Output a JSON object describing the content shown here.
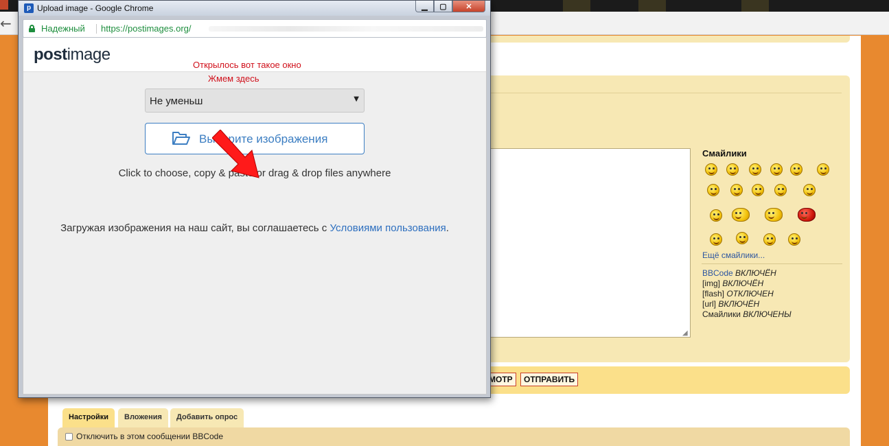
{
  "popup": {
    "window_title": "Upload image - Google Chrome",
    "favicon_letter": "p",
    "window_buttons": {
      "minimize": "▁",
      "maximize": "▢",
      "close": "✕"
    },
    "address_bar": {
      "secure_label": "Надежный",
      "url": "https://postimages.org/"
    },
    "logo": {
      "part1": "post",
      "part2": "image"
    },
    "annotations": [
      "Открылось вот такое окно",
      "Жмем здесь"
    ],
    "resize_select": {
      "value": "Не уменьш",
      "arrow": "▼"
    },
    "choose_button": {
      "label": "Выберите изображения"
    },
    "hint": "Click to choose, copy & paste or drag & drop files anywhere",
    "terms": {
      "prefix": "Загружая изображения на наш сайт, вы соглашаетесь с ",
      "link": "Условиями пользования",
      "suffix": "."
    }
  },
  "forum": {
    "smilies": {
      "title": "Смайлики",
      "more_link": "Ещё смайлики..."
    },
    "bbcode_status": [
      {
        "name": "BBCode",
        "value": "ВКЛЮЧЁН"
      },
      {
        "name": "[img]",
        "value": "ВКЛЮЧЁН"
      },
      {
        "name": "[flash]",
        "value": "ОТКЛЮЧЕН"
      },
      {
        "name": "[url]",
        "value": "ВКЛЮЧЁН"
      },
      {
        "name": "Смайлики",
        "value": "ВКЛЮЧЕНЫ"
      }
    ],
    "buttons": {
      "preview": "МОТР",
      "send": "ОТПРАВИТЬ"
    },
    "tabs": [
      "Настройки",
      "Вложения",
      "Добавить опрос"
    ],
    "options": [
      "Отключить в этом сообщении BBCode"
    ]
  }
}
